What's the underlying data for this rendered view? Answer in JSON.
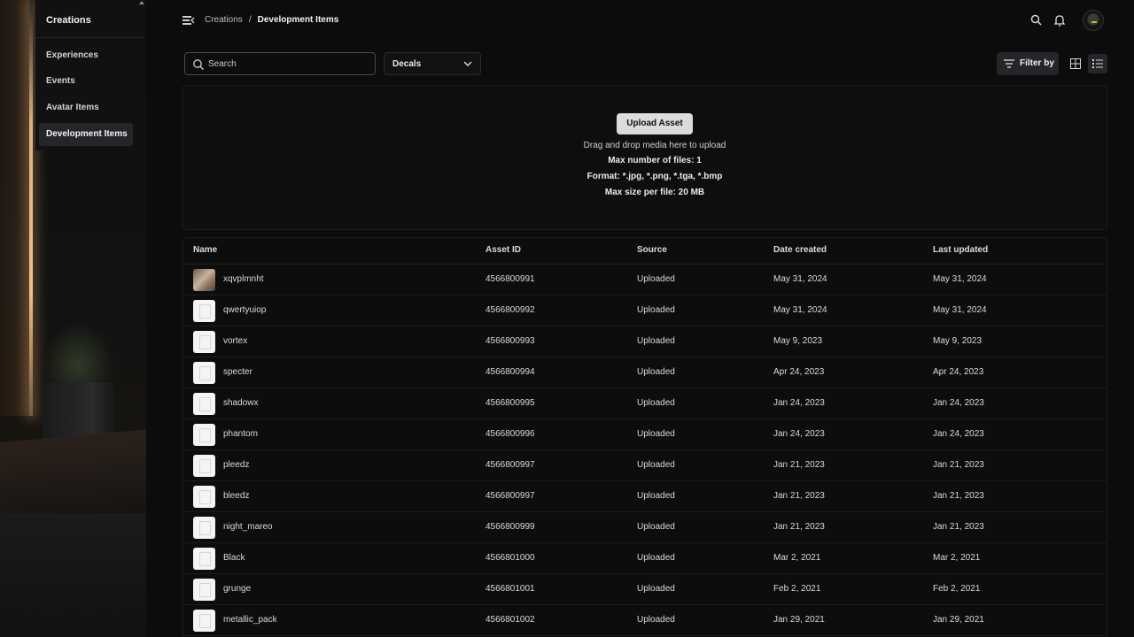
{
  "sidebar": {
    "title": "Creations",
    "items": [
      {
        "label": "Experiences",
        "active": false
      },
      {
        "label": "Events",
        "active": false
      },
      {
        "label": "Avatar Items",
        "active": false
      },
      {
        "label": "Development Items",
        "active": true
      }
    ]
  },
  "header": {
    "breadcrumb_parent": "Creations",
    "breadcrumb_sep": "/",
    "breadcrumb_current": "Development Items",
    "icons": [
      "menu-collapse-icon",
      "search-icon",
      "bell-icon",
      "avatar"
    ]
  },
  "toolbar": {
    "search_placeholder": "Search",
    "asset_type": "Decals",
    "filter_label": "Filter by",
    "view_mode": "list"
  },
  "upload": {
    "button_label": "Upload Asset",
    "hint": "Drag and drop media here to upload",
    "max_files": "Max number of files: 1",
    "formats": "Format: *.jpg, *.png, *.tga, *.bmp",
    "max_size": "Max size per file: 20 MB"
  },
  "table": {
    "columns": [
      "Name",
      "Asset ID",
      "Source",
      "Date created",
      "Last updated"
    ],
    "rows": [
      {
        "name": "xqvplmnht",
        "asset_id": "4566800991",
        "source": "Uploaded",
        "created": "May 31, 2024",
        "updated": "May 31, 2024",
        "thumb": "photo"
      },
      {
        "name": "qwertyuiop",
        "asset_id": "4566800992",
        "source": "Uploaded",
        "created": "May 31, 2024",
        "updated": "May 31, 2024",
        "thumb": "blank"
      },
      {
        "name": "vortex",
        "asset_id": "4566800993",
        "source": "Uploaded",
        "created": "May 9, 2023",
        "updated": "May 9, 2023",
        "thumb": "blank"
      },
      {
        "name": "specter",
        "asset_id": "4566800994",
        "source": "Uploaded",
        "created": "Apr 24, 2023",
        "updated": "Apr 24, 2023",
        "thumb": "blank"
      },
      {
        "name": "shadowx",
        "asset_id": "4566800995",
        "source": "Uploaded",
        "created": "Jan 24, 2023",
        "updated": "Jan 24, 2023",
        "thumb": "blank"
      },
      {
        "name": "phantom",
        "asset_id": "4566800996",
        "source": "Uploaded",
        "created": "Jan 24, 2023",
        "updated": "Jan 24, 2023",
        "thumb": "blank"
      },
      {
        "name": "pleedz",
        "asset_id": "4566800997",
        "source": "Uploaded",
        "created": "Jan 21, 2023",
        "updated": "Jan 21, 2023",
        "thumb": "blank"
      },
      {
        "name": "bleedz",
        "asset_id": "4566800997",
        "source": "Uploaded",
        "created": "Jan 21, 2023",
        "updated": "Jan 21, 2023",
        "thumb": "blank"
      },
      {
        "name": "night_mareo",
        "asset_id": "4566800999",
        "source": "Uploaded",
        "created": "Jan 21, 2023",
        "updated": "Jan 21, 2023",
        "thumb": "blank"
      },
      {
        "name": "Black",
        "asset_id": "4566801000",
        "source": "Uploaded",
        "created": "Mar 2, 2021",
        "updated": "Mar 2, 2021",
        "thumb": "blank"
      },
      {
        "name": "grunge",
        "asset_id": "4566801001",
        "source": "Uploaded",
        "created": "Feb 2, 2021",
        "updated": "Feb 2, 2021",
        "thumb": "blank"
      },
      {
        "name": "metallic_pack",
        "asset_id": "4566801002",
        "source": "Uploaded",
        "created": "Jan 29, 2021",
        "updated": "Jan 29, 2021",
        "thumb": "blank"
      }
    ]
  },
  "colors": {
    "background": "#0c0c0d",
    "active_item": "#26262a",
    "accent_glow": "#ffc88c",
    "button_light": "#dcdcdc"
  }
}
